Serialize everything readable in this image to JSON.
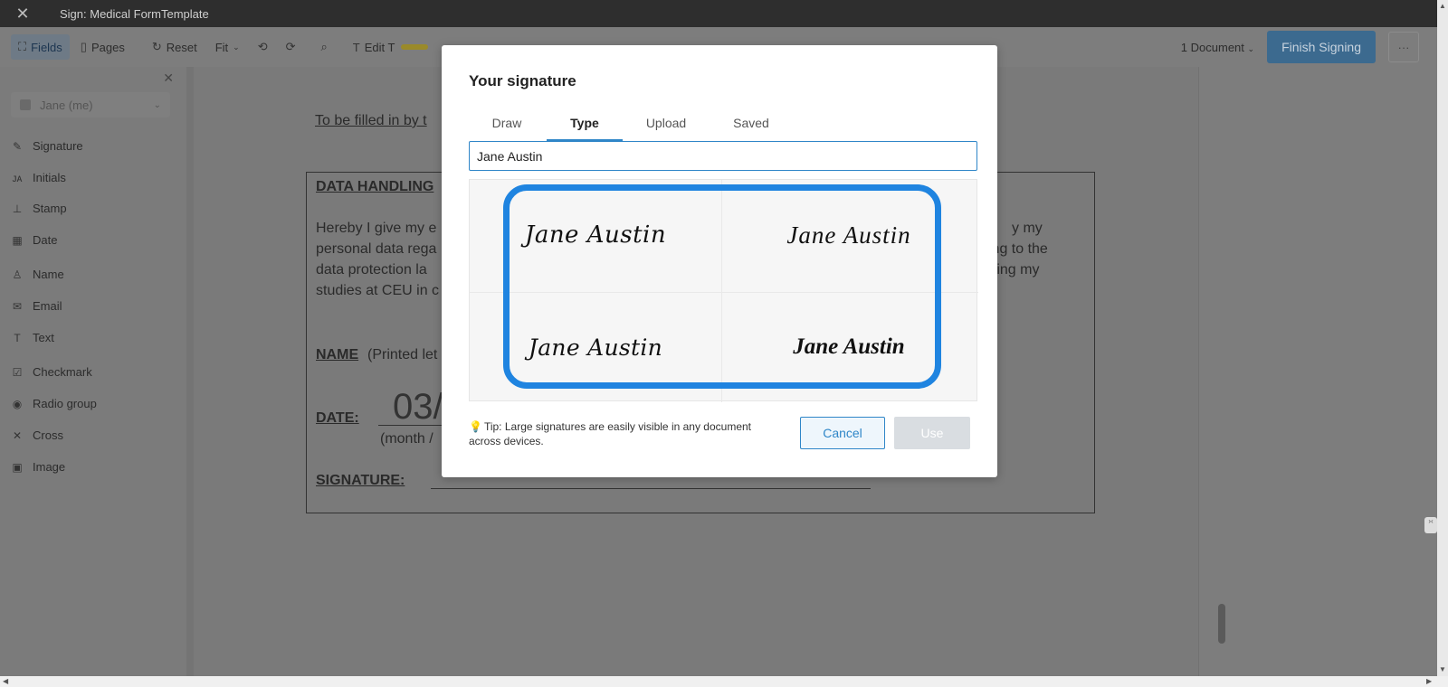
{
  "window": {
    "title": "Sign: Medical FormTemplate"
  },
  "toolbar": {
    "fields_label": "Fields",
    "pages_label": "Pages",
    "reset_label": "Reset",
    "fit_label": "Fit",
    "edit_label": "Edit T",
    "document_count": "1 Document",
    "finish_label": "Finish Signing",
    "more_label": "···"
  },
  "sidebar": {
    "signer": "Jane (me)",
    "items": [
      {
        "label": "Signature",
        "icon": "pen-icon"
      },
      {
        "label": "Initials",
        "icon": "initials-icon"
      },
      {
        "label": "Stamp",
        "icon": "stamp-icon"
      },
      {
        "label": "Date",
        "icon": "calendar-icon"
      },
      {
        "label": "Name",
        "icon": "person-icon"
      },
      {
        "label": "Email",
        "icon": "mail-icon"
      },
      {
        "label": "Text",
        "icon": "text-icon"
      },
      {
        "label": "Checkmark",
        "icon": "checkbox-icon"
      },
      {
        "label": "Radio group",
        "icon": "radio-icon"
      },
      {
        "label": "Cross",
        "icon": "cross-icon"
      },
      {
        "label": "Image",
        "icon": "image-icon"
      }
    ]
  },
  "document": {
    "intro": "To be filled in by t",
    "heading": "DATA HANDLING",
    "para_left": [
      "Hereby I give my e",
      "personal data rega",
      "data protection la",
      "studies at CEU in c"
    ],
    "para_right": [
      "y my",
      "ing to the",
      "ring my"
    ],
    "name_label": "NAME",
    "name_hint": "(Printed let",
    "date_label": "DATE:",
    "date_value": "03/",
    "date_hint": "(month /",
    "signature_label": "SIGNATURE:"
  },
  "modal": {
    "title": "Your signature",
    "tabs": [
      "Draw",
      "Type",
      "Upload",
      "Saved"
    ],
    "active_tab": "Type",
    "input_value": "Jane Austin",
    "signatures": [
      "Jane Austin",
      "Jane Austin",
      "Jane Austin",
      "Jane Austin"
    ],
    "tip": "Tip: Large signatures are easily visible in any document across devices.",
    "cancel_label": "Cancel",
    "use_label": "Use",
    "highlight_color": "#1f84e0",
    "accent_color": "#2f86c8"
  }
}
